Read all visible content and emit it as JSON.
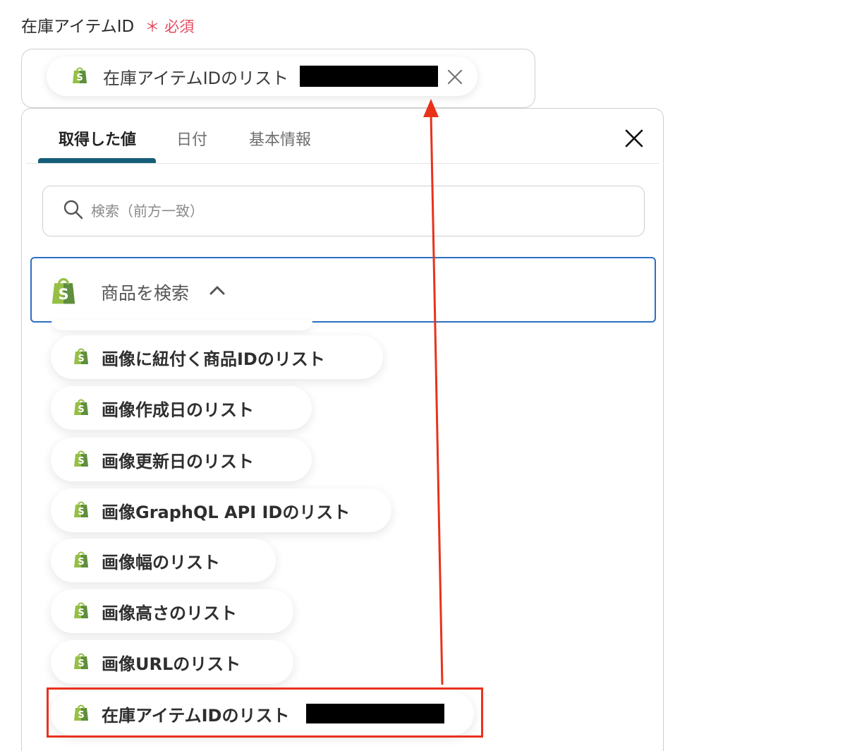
{
  "field": {
    "label": "在庫アイテムID",
    "required_mark": "＊",
    "required_text": "必須"
  },
  "selected": {
    "label": "在庫アイテムIDのリスト",
    "icon": "shopify-icon",
    "close_icon": "close-icon"
  },
  "tabs": [
    {
      "label": "取得した値",
      "active": true
    },
    {
      "label": "日付",
      "active": false
    },
    {
      "label": "基本情報",
      "active": false
    }
  ],
  "search": {
    "placeholder": "検索（前方一致）",
    "value": ""
  },
  "group": {
    "label": "商品を検索",
    "icon": "shopify-icon",
    "expanded": true
  },
  "items": [
    {
      "label": "画像に紐付く商品IDのリスト"
    },
    {
      "label": "画像作成日のリスト"
    },
    {
      "label": "画像更新日のリスト"
    },
    {
      "label": "画像GraphQL API IDのリスト"
    },
    {
      "label": "画像幅のリスト"
    },
    {
      "label": "画像高さのリスト"
    },
    {
      "label": "画像URLのリスト"
    },
    {
      "label": "在庫アイテムIDのリスト",
      "highlighted": true
    }
  ],
  "colors": {
    "tab_active_underline": "#165e78",
    "group_border": "#2b6fc4",
    "annotation": "#e8321c",
    "required": "#e24a5d",
    "shopify_green": "#95bf47"
  }
}
